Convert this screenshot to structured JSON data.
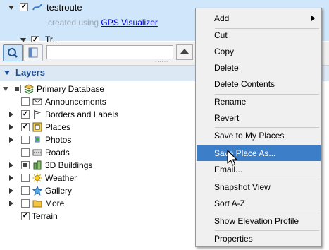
{
  "places": {
    "route_name": "testroute",
    "created_prefix": "created using ",
    "created_link": "GPS Visualizer",
    "partial_label": "Tr..."
  },
  "layers": {
    "title": "Layers",
    "items": [
      {
        "label": "Primary Database",
        "checked": "partial",
        "icon": "database-icon"
      },
      {
        "label": "Announcements",
        "checked": false,
        "icon": "envelope-icon"
      },
      {
        "label": "Borders and Labels",
        "checked": true,
        "icon": "flag-icon"
      },
      {
        "label": "Places",
        "checked": true,
        "icon": "places-icon"
      },
      {
        "label": "Photos",
        "checked": false,
        "icon": "photo-icon"
      },
      {
        "label": "Roads",
        "checked": false,
        "icon": "road-icon"
      },
      {
        "label": "3D Buildings",
        "checked": "partial",
        "icon": "building-icon"
      },
      {
        "label": "Weather",
        "checked": false,
        "icon": "sun-icon"
      },
      {
        "label": "Gallery",
        "checked": false,
        "icon": "star-icon"
      },
      {
        "label": "More",
        "checked": false,
        "icon": "folder-icon"
      },
      {
        "label": "Terrain",
        "checked": true,
        "icon": ""
      }
    ]
  },
  "context_menu": {
    "items": [
      {
        "label": "Add",
        "submenu": true
      },
      {
        "label": "Cut"
      },
      {
        "label": "Copy"
      },
      {
        "label": "Delete"
      },
      {
        "label": "Delete Contents"
      },
      {
        "label": "Rename"
      },
      {
        "label": "Revert"
      },
      {
        "label": "Save to My Places"
      },
      {
        "label": "Save Place As...",
        "highlighted": true
      },
      {
        "label": "Email..."
      },
      {
        "label": "Snapshot View"
      },
      {
        "label": "Sort A-Z"
      },
      {
        "label": "Show Elevation Profile"
      },
      {
        "label": "Properties"
      }
    ]
  },
  "colors": {
    "highlight": "#3d7ec8",
    "places_bg": "#cfe6fb",
    "layers_title": "#1e4f91"
  }
}
